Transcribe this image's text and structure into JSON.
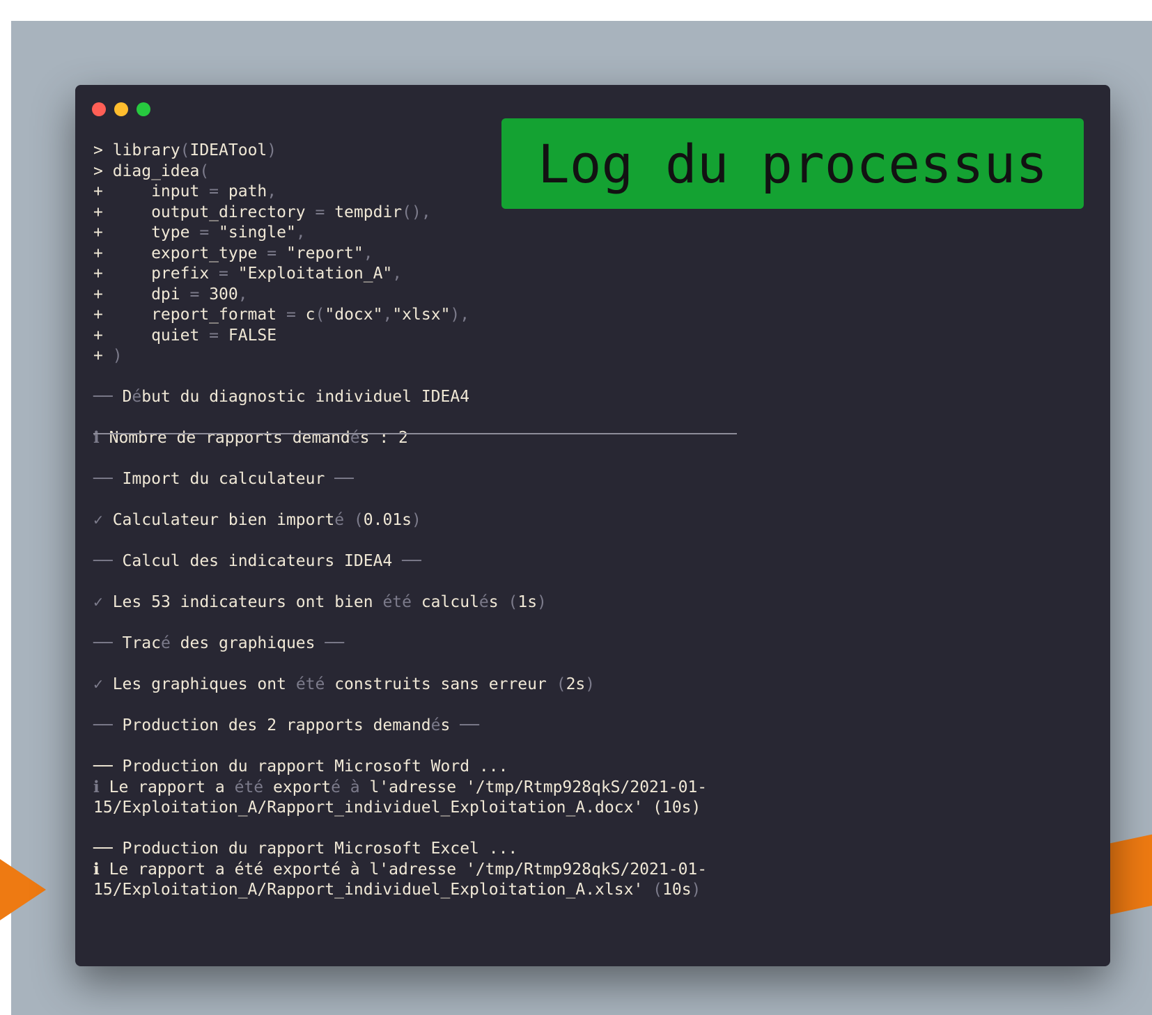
{
  "window": {
    "title_banner": "Log du processus",
    "controls": [
      "close",
      "minimize",
      "zoom"
    ]
  },
  "console": {
    "lines": [
      [
        {
          "t": "> library",
          "c": "w"
        },
        {
          "t": "(",
          "c": "g"
        },
        {
          "t": "IDEATool",
          "c": "w"
        },
        {
          "t": ")",
          "c": "g"
        }
      ],
      [
        {
          "t": "> diag_idea",
          "c": "w"
        },
        {
          "t": "(",
          "c": "g"
        }
      ],
      [
        {
          "t": "+     input ",
          "c": "w"
        },
        {
          "t": "=",
          "c": "g"
        },
        {
          "t": " path",
          "c": "w"
        },
        {
          "t": ",",
          "c": "g"
        }
      ],
      [
        {
          "t": "+     output_directory ",
          "c": "w"
        },
        {
          "t": "=",
          "c": "g"
        },
        {
          "t": " tempdir",
          "c": "w"
        },
        {
          "t": "(),",
          "c": "g"
        }
      ],
      [
        {
          "t": "+     type ",
          "c": "w"
        },
        {
          "t": "=",
          "c": "g"
        },
        {
          "t": " \"single\"",
          "c": "w"
        },
        {
          "t": ",",
          "c": "g"
        }
      ],
      [
        {
          "t": "+     export_type ",
          "c": "w"
        },
        {
          "t": "=",
          "c": "g"
        },
        {
          "t": " \"report\"",
          "c": "w"
        },
        {
          "t": ",",
          "c": "g"
        }
      ],
      [
        {
          "t": "+     prefix ",
          "c": "w"
        },
        {
          "t": "=",
          "c": "g"
        },
        {
          "t": " \"Exploitation_A\"",
          "c": "w"
        },
        {
          "t": ",",
          "c": "g"
        }
      ],
      [
        {
          "t": "+     dpi ",
          "c": "w"
        },
        {
          "t": "=",
          "c": "g"
        },
        {
          "t": " 300",
          "c": "w"
        },
        {
          "t": ",",
          "c": "g"
        }
      ],
      [
        {
          "t": "+     report_format ",
          "c": "w"
        },
        {
          "t": "=",
          "c": "g"
        },
        {
          "t": " c",
          "c": "w"
        },
        {
          "t": "(",
          "c": "g"
        },
        {
          "t": "\"docx\"",
          "c": "w"
        },
        {
          "t": ",",
          "c": "g"
        },
        {
          "t": "\"xlsx\"",
          "c": "w"
        },
        {
          "t": "),",
          "c": "g"
        }
      ],
      [
        {
          "t": "+     quiet ",
          "c": "w"
        },
        {
          "t": "=",
          "c": "g"
        },
        {
          "t": " FALSE",
          "c": "w"
        }
      ],
      [
        {
          "t": "+ ",
          "c": "w"
        },
        {
          "t": ")",
          "c": "g"
        }
      ],
      [],
      [
        {
          "t": "── ",
          "c": "g"
        },
        {
          "t": "D",
          "c": "w"
        },
        {
          "t": "é",
          "c": "g"
        },
        {
          "t": "but du diagnostic individuel IDEA4",
          "c": "w"
        }
      ],
      [],
      [
        {
          "t": "ℹ ",
          "c": "g"
        },
        {
          "t": "Nombre de rapports demand",
          "c": "w"
        },
        {
          "t": "é",
          "c": "g"
        },
        {
          "t": "s : 2",
          "c": "w"
        }
      ],
      [],
      [
        {
          "t": "── ",
          "c": "g"
        },
        {
          "t": "Import du calculateur",
          "c": "w"
        },
        {
          "t": " ──",
          "c": "g"
        }
      ],
      [],
      [
        {
          "t": "✓ ",
          "c": "g"
        },
        {
          "t": "Calculateur bien import",
          "c": "w"
        },
        {
          "t": "é (",
          "c": "g"
        },
        {
          "t": "0.01s",
          "c": "w"
        },
        {
          "t": ")",
          "c": "g"
        }
      ],
      [],
      [
        {
          "t": "── ",
          "c": "g"
        },
        {
          "t": "Calcul des indicateurs IDEA4",
          "c": "w"
        },
        {
          "t": " ──",
          "c": "g"
        }
      ],
      [],
      [
        {
          "t": "✓ ",
          "c": "g"
        },
        {
          "t": "Les 53 indicateurs ont bien ",
          "c": "w"
        },
        {
          "t": "été",
          "c": "g"
        },
        {
          "t": " calcul",
          "c": "w"
        },
        {
          "t": "é",
          "c": "g"
        },
        {
          "t": "s ",
          "c": "w"
        },
        {
          "t": "(",
          "c": "g"
        },
        {
          "t": "1s",
          "c": "w"
        },
        {
          "t": ")",
          "c": "g"
        }
      ],
      [],
      [
        {
          "t": "── ",
          "c": "g"
        },
        {
          "t": "Trac",
          "c": "w"
        },
        {
          "t": "é",
          "c": "g"
        },
        {
          "t": " des graphiques",
          "c": "w"
        },
        {
          "t": " ──",
          "c": "g"
        }
      ],
      [],
      [
        {
          "t": "✓ ",
          "c": "g"
        },
        {
          "t": "Les graphiques ont ",
          "c": "w"
        },
        {
          "t": "été",
          "c": "g"
        },
        {
          "t": " construits sans erreur ",
          "c": "w"
        },
        {
          "t": "(",
          "c": "g"
        },
        {
          "t": "2s",
          "c": "w"
        },
        {
          "t": ")",
          "c": "g"
        }
      ],
      [],
      [
        {
          "t": "── ",
          "c": "g"
        },
        {
          "t": "Production des 2 rapports demand",
          "c": "w"
        },
        {
          "t": "é",
          "c": "g"
        },
        {
          "t": "s",
          "c": "w"
        },
        {
          "t": " ──",
          "c": "g"
        }
      ],
      [],
      [
        {
          "t": "── Production du rapport Microsoft Word ...",
          "c": "w"
        }
      ],
      [
        {
          "t": "ℹ ",
          "c": "g"
        },
        {
          "t": "Le rapport a ",
          "c": "w"
        },
        {
          "t": "été",
          "c": "g"
        },
        {
          "t": " export",
          "c": "w"
        },
        {
          "t": "é à",
          "c": "g"
        },
        {
          "t": " l'adresse '/tmp/Rtmp928qkS/2021-01-",
          "c": "w"
        }
      ],
      [
        {
          "t": "15/Exploitation_A/Rapport_individuel_Exploitation_A.docx' (10s)",
          "c": "w"
        }
      ],
      [],
      [
        {
          "t": "── Production du rapport Microsoft Excel ...",
          "c": "w"
        }
      ],
      [
        {
          "t": "ℹ Le rapport a été exporté à l'adresse '/tmp/Rtmp928qkS/2021-01-",
          "c": "w"
        }
      ],
      [
        {
          "t": "15/Exploitation_A/Rapport_individuel_Exploitation_A.xlsx' ",
          "c": "w"
        },
        {
          "t": "(",
          "c": "g"
        },
        {
          "t": "10s",
          "c": "w"
        },
        {
          "t": ")",
          "c": "g"
        }
      ]
    ]
  }
}
